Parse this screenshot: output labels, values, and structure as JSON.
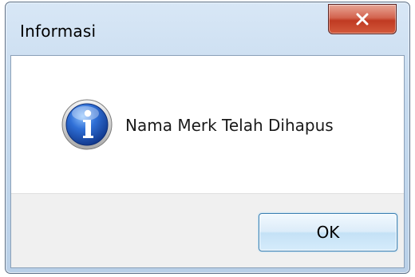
{
  "window": {
    "title": "Informasi",
    "close_icon": "close-x-icon"
  },
  "dialog": {
    "icon": "information-icon",
    "message": "Nama Merk Telah Dihapus",
    "ok_label": "OK"
  },
  "colors": {
    "close_button": "#c73e22",
    "ok_border": "#3c7fb1",
    "info_icon": "#1f5fc4"
  }
}
